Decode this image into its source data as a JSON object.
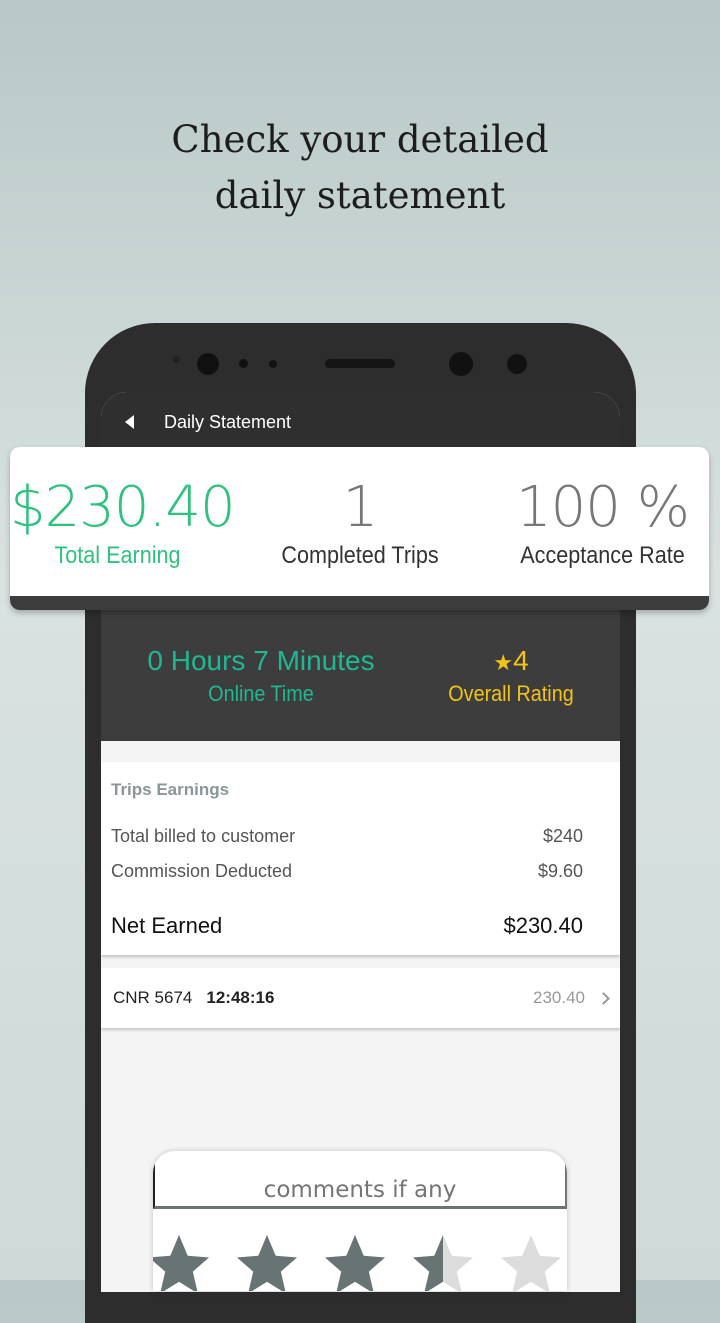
{
  "headline": {
    "line1": "Check your detailed",
    "line2": "daily statement"
  },
  "appbar": {
    "title": "Daily Statement"
  },
  "summary": {
    "total_earning": "$230.40",
    "total_earning_label": "Total Earning",
    "completed_trips": "1",
    "completed_trips_label": "Completed Trips",
    "acceptance_rate": "100 %",
    "acceptance_rate_label": "Acceptance Rate"
  },
  "online": {
    "value": "0 Hours 7 Minutes",
    "label": "Online Time"
  },
  "rating": {
    "value": "4",
    "label": "Overall Rating"
  },
  "trips_earnings": {
    "title": "Trips Earnings",
    "rows": [
      {
        "label": "Total billed to customer",
        "value": "$240"
      },
      {
        "label": "Commission Deducted",
        "value": "$9.60"
      }
    ],
    "net_label": "Net Earned",
    "net_value": "$230.40"
  },
  "trip": {
    "id": "CNR 5674",
    "time": "12:48:16",
    "amount": "230.40"
  },
  "feedback": {
    "placeholder": "comments if any",
    "stars_value": 3.5,
    "stars_max": 5
  },
  "colors": {
    "green": "#2ec27e",
    "teal": "#1fb893",
    "yellow": "#f2c417",
    "dark": "#3d3d3d",
    "star_filled": "#687474",
    "star_empty": "#dcdcdc"
  }
}
